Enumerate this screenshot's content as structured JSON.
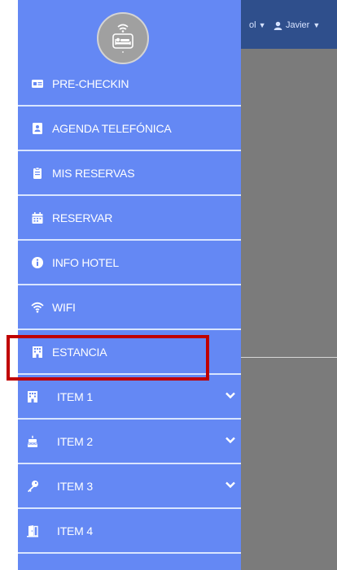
{
  "topbar": {
    "language_label": "ol",
    "user_name": "Javier"
  },
  "menu": {
    "items": [
      {
        "label": "PRE-CHECKIN",
        "icon": "id-card-icon"
      },
      {
        "label": "AGENDA TELEFÓNICA",
        "icon": "address-book-icon"
      },
      {
        "label": "MIS RESERVAS",
        "icon": "clipboard-icon"
      },
      {
        "label": "RESERVAR",
        "icon": "calendar-icon"
      },
      {
        "label": "INFO HOTEL",
        "icon": "info-icon"
      },
      {
        "label": "WIFI",
        "icon": "wifi-icon"
      },
      {
        "label": "ESTANCIA",
        "icon": "building-icon"
      },
      {
        "label": "ITEM 1",
        "icon": "building-icon",
        "has_submenu": true
      },
      {
        "label": "ITEM 2",
        "icon": "cake-icon",
        "has_submenu": true
      },
      {
        "label": "ITEM 3",
        "icon": "key-icon",
        "has_submenu": true
      },
      {
        "label": "ITEM 4",
        "icon": "door-icon"
      }
    ]
  },
  "colors": {
    "sidebar": "#6488f4",
    "backdrop": "#7b7b7b",
    "topbar": "#2f4f8c",
    "highlight": "#c00000"
  }
}
